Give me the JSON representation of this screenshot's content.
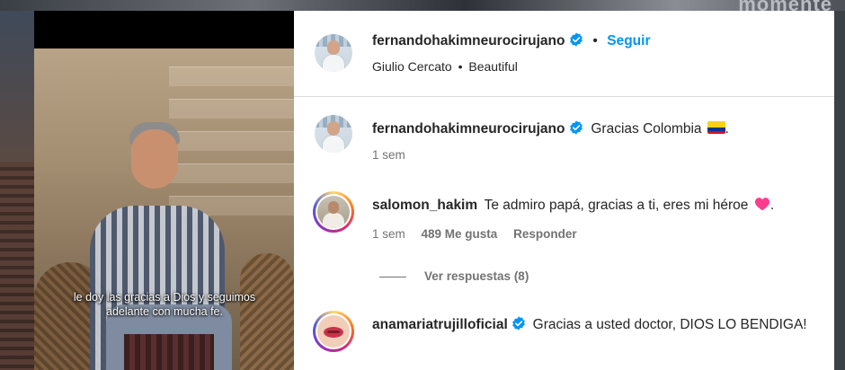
{
  "background": {
    "partial_text": "momente"
  },
  "video": {
    "subtitle": "le doy las gracias a Dios y seguimos adelante con mucha fe."
  },
  "post_header": {
    "username": "fernandohakimneurocirujano",
    "follow_label": "Seguir",
    "separator": "•",
    "audio_artist": "Giulio Cercato",
    "audio_track": "Beautiful"
  },
  "caption": {
    "username": "fernandohakimneurocirujano",
    "text": "Gracias Colombia",
    "trailing": ".",
    "flag": "colombia-flag-emoji",
    "time": "1 sem"
  },
  "comments": [
    {
      "username": "salomon_hakim",
      "text": "Te admiro papá, gracias a ti, eres mi héroe",
      "emoji": "pink-heart",
      "trailing": ".",
      "time": "1 sem",
      "likes": "489 Me gusta",
      "reply_label": "Responder",
      "view_replies": "Ver respuestas (8)"
    },
    {
      "username": "anamariatrujilloficial",
      "text": "Gracias a usted doctor, DIOS LO BENDIGA!",
      "verified": true
    }
  ],
  "colors": {
    "accent": "#0095f6",
    "verified": "#0095f6",
    "heart": "#ff3c8e",
    "text": "#262626",
    "muted": "#737373"
  }
}
